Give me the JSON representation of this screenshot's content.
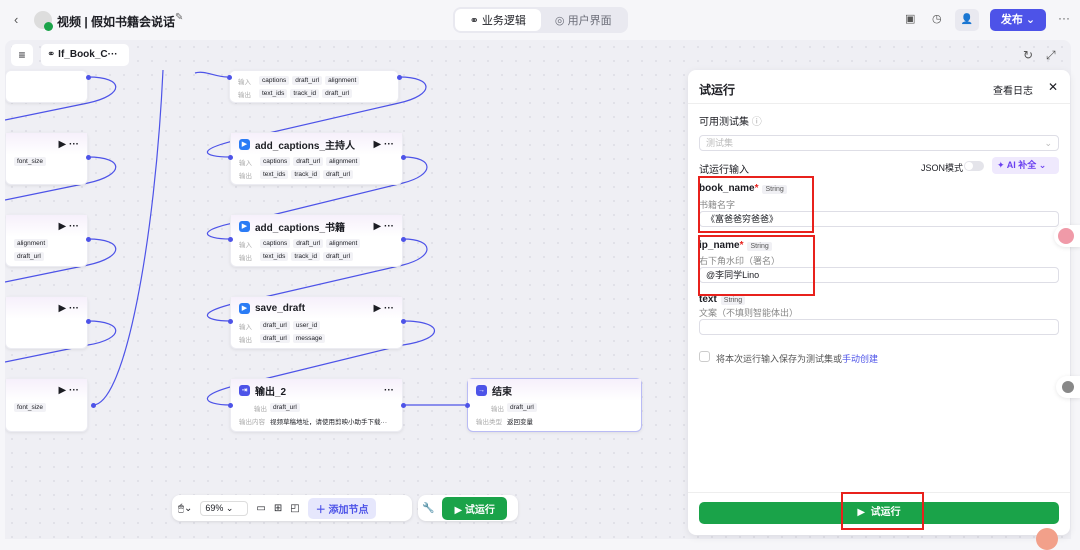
{
  "header": {
    "title": "视频 | 假如书籍会说话",
    "tabs": [
      {
        "label": "业务逻辑"
      },
      {
        "label": "用户界面"
      }
    ],
    "publish": "发布"
  },
  "canvas": {
    "workflow_name": "If_Book_C···"
  },
  "nodes": {
    "n0": {
      "in": [
        "captions",
        "draft_url",
        "alignment"
      ],
      "out": [
        "text_ids",
        "track_id",
        "draft_url"
      ]
    },
    "n1": {
      "title": "add_captions_主持人",
      "in": [
        "captions",
        "draft_url",
        "alignment"
      ],
      "out": [
        "text_ids",
        "track_id",
        "draft_url"
      ]
    },
    "n2": {
      "title": "add_captions_书籍",
      "in": [
        "captions",
        "draft_url",
        "alignment"
      ],
      "out": [
        "text_ids",
        "track_id",
        "draft_url"
      ]
    },
    "n3": {
      "title": "save_draft",
      "in": [
        "draft_url",
        "user_id"
      ],
      "out": [
        "draft_url",
        "message"
      ]
    },
    "n4": {
      "title": "输出_2",
      "out_label": "输出",
      "out": "draft_url",
      "content_label": "输出内容",
      "content": "视频草稿地址，请使用剪映小助手下载···"
    },
    "end": {
      "title": "结束",
      "out_label": "输出",
      "out": "draft_url",
      "type_label": "输出类型",
      "type": "返回变量"
    },
    "left": {
      "l1": "font_size",
      "l2a": "alignment",
      "l2b": "draft_url",
      "l4": "font_size"
    },
    "in_label": "输入",
    "out_label": "输出"
  },
  "toolbar": {
    "zoom": "69%",
    "add_node": "添加节点",
    "run": "试运行"
  },
  "panel": {
    "title": "试运行",
    "view_log": "查看日志",
    "testset_label": "可用测试集",
    "testset_placeholder": "测试集",
    "input_label": "试运行输入",
    "json_mode": "JSON模式",
    "ai_fill": "AI 补全",
    "fields": [
      {
        "name": "book_name",
        "type": "String",
        "desc": "书籍名字",
        "value": "《富爸爸穷爸爸》"
      },
      {
        "name": "ip_name",
        "type": "String",
        "desc": "右下角水印（署名）",
        "value": "@李同学Lino"
      },
      {
        "name": "text",
        "type": "String",
        "desc": "文案（不填则智能体出）",
        "value": ""
      }
    ],
    "save_text": "将本次运行输入保存为测试集或",
    "save_link": "手动创建",
    "run": "试运行"
  }
}
